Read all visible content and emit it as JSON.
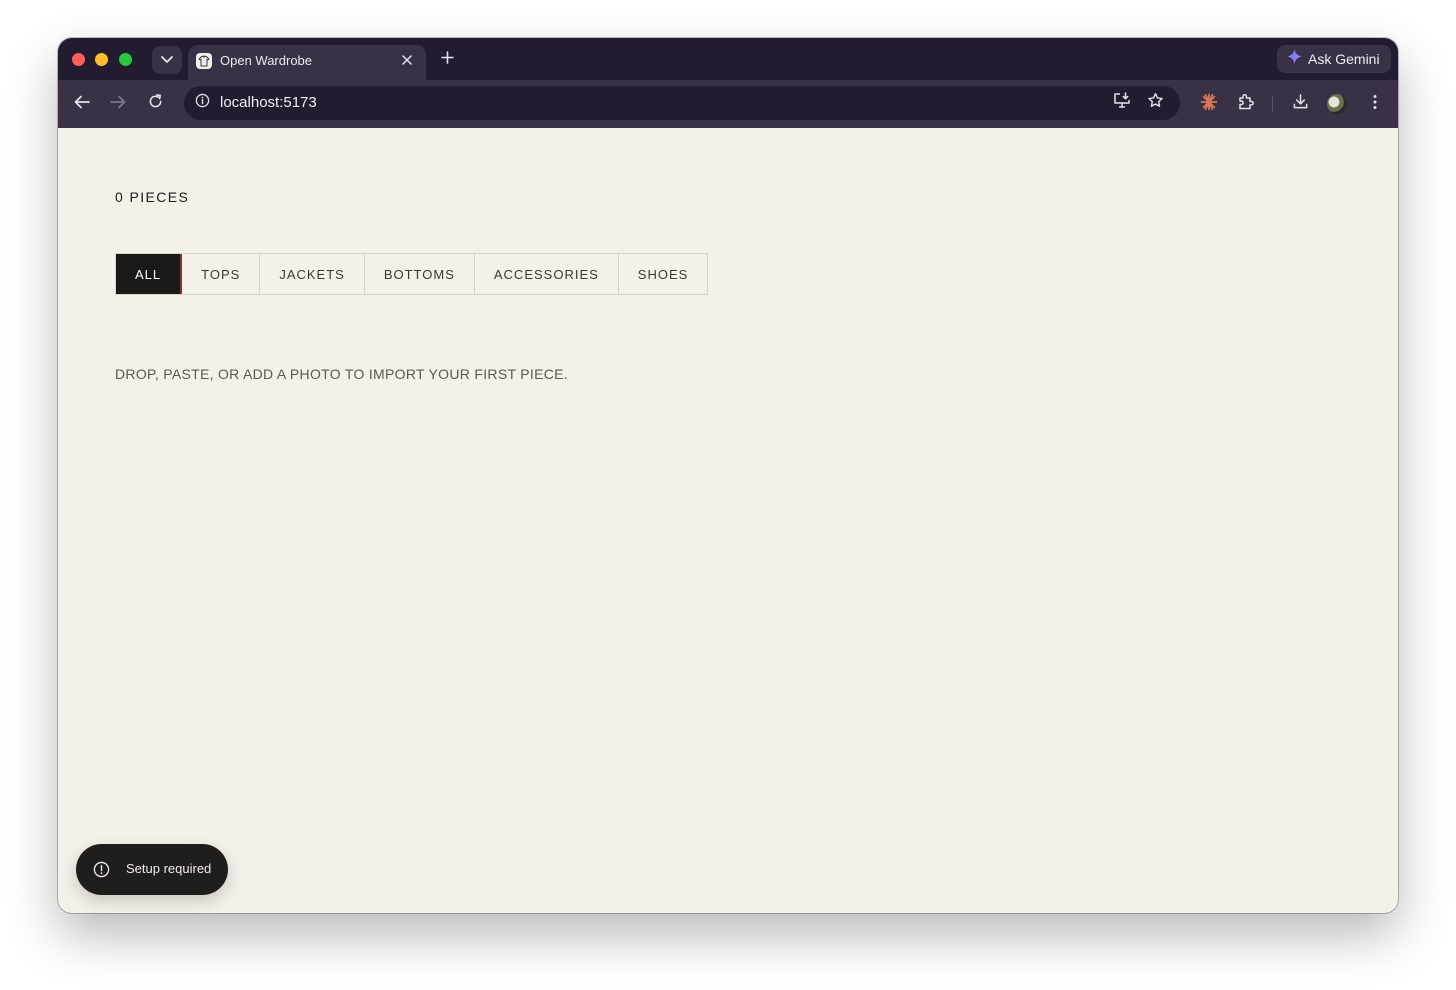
{
  "browser": {
    "tab_title": "Open Wardrobe",
    "url": "localhost:5173",
    "ask_gemini_label": "Ask Gemini"
  },
  "app": {
    "piece_count_label": "0 PIECES",
    "filters": [
      {
        "label": "ALL",
        "active": true
      },
      {
        "label": "TOPS",
        "active": false
      },
      {
        "label": "JACKETS",
        "active": false
      },
      {
        "label": "BOTTOMS",
        "active": false
      },
      {
        "label": "ACCESSORIES",
        "active": false
      },
      {
        "label": "SHOES",
        "active": false
      }
    ],
    "empty_message": "DROP, PASTE, OR ADD A PHOTO TO IMPORT YOUR FIRST PIECE.",
    "toast_label": "Setup required"
  },
  "colors": {
    "chrome_dark": "#231b30",
    "chrome_mid": "#3a3146",
    "page_bg": "#f4f0ea",
    "active_filter_bg": "#1a1918",
    "toast_bg": "#1f1e1d"
  },
  "icons": [
    "tab-list-icon",
    "favicon-icon",
    "close-icon",
    "plus-icon",
    "gemini-sparkle-icon",
    "back-arrow-icon",
    "forward-arrow-icon",
    "reload-icon",
    "site-info-icon",
    "install-app-icon",
    "star-icon",
    "claude-extension-icon",
    "extensions-puzzle-icon",
    "download-icon",
    "kebab-menu-icon",
    "alert-circle-icon"
  ]
}
